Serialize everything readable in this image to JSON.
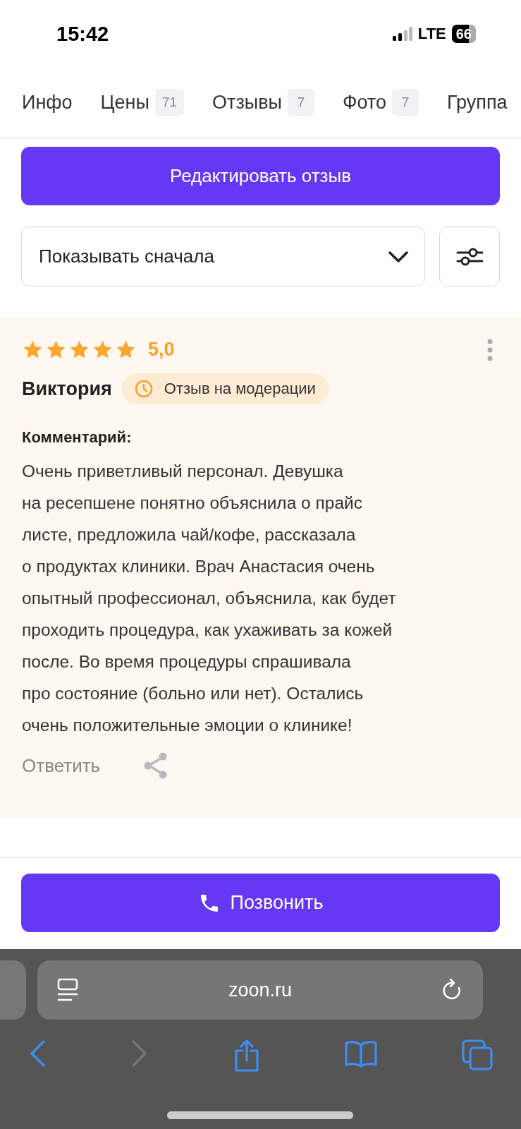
{
  "status_bar": {
    "time": "15:42",
    "network": "LTE",
    "battery": "66"
  },
  "tabs": [
    {
      "label": "Инфо"
    },
    {
      "label": "Цены",
      "count": "71"
    },
    {
      "label": "Отзывы",
      "count": "7"
    },
    {
      "label": "Фото",
      "count": "7"
    },
    {
      "label": "Группа"
    }
  ],
  "edit_button": "Редактировать отзыв",
  "sort": {
    "value": "Показывать сначала"
  },
  "review": {
    "stars": 5,
    "rating": "5,0",
    "author": "Виктория",
    "status": "Отзыв на модерации",
    "comment_label": "Комментарий:",
    "text": "Очень приветливый персонал. Девушка\nна ресепшене понятно объяснила о прайс\nлисте, предложила чай/кофе, рассказала\nо продуктах клиники. Врач Анастасия очень\nопытный профессионал, объяснила, как будет\nпроходить процедура, как ухаживать за кожей\nпосле. Во время процедуры спрашивала\nпро состояние (больно или нет). Остались\nочень положительные эмоции о клинике!",
    "reply": "Ответить"
  },
  "call_button": "Позвонить",
  "browser": {
    "url": "zoon.ru"
  }
}
